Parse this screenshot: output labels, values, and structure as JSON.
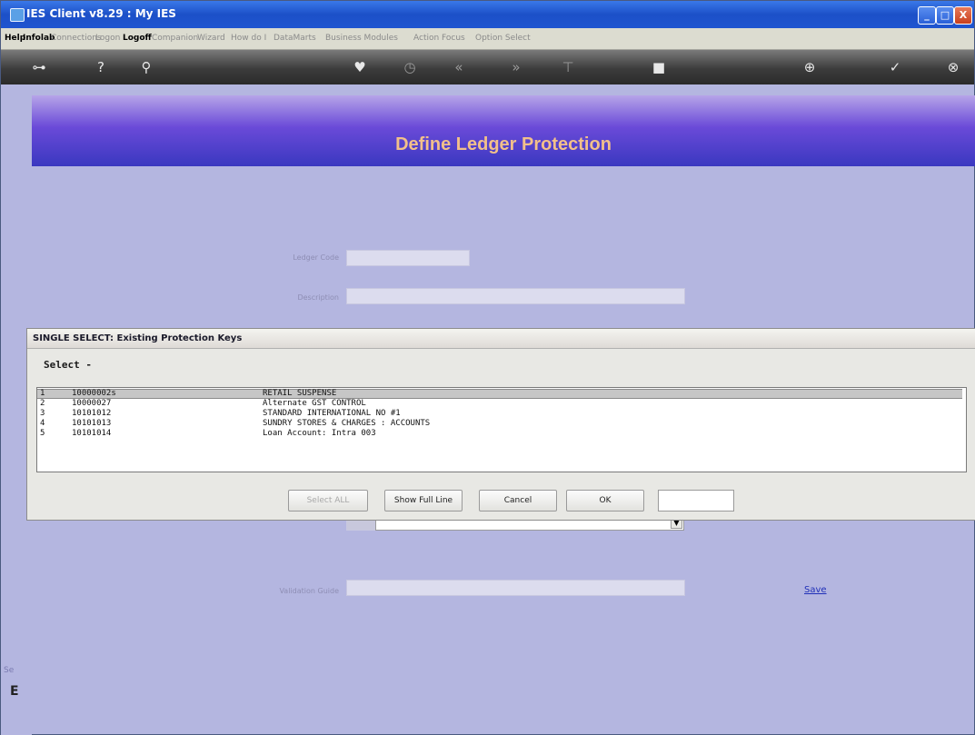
{
  "window": {
    "title": "IES Client v8.29 : My IES",
    "controls": [
      "_",
      "□",
      "X"
    ]
  },
  "menu": [
    {
      "label": "Help",
      "enabled": true
    },
    {
      "label": "Infolab",
      "enabled": true
    },
    {
      "label": "Connections",
      "enabled": false
    },
    {
      "label": "Logon",
      "enabled": false
    },
    {
      "label": "Logoff",
      "enabled": true
    },
    {
      "label": "Companion",
      "enabled": false
    },
    {
      "label": "Wizard",
      "enabled": false
    },
    {
      "label": "How do I",
      "enabled": false
    },
    {
      "label": "DataMarts",
      "enabled": false
    },
    {
      "label": "Business Modules",
      "enabled": false
    },
    {
      "label": "Action Focus",
      "enabled": false
    },
    {
      "label": "Option Select",
      "enabled": false
    }
  ],
  "toolbar": {
    "icons": [
      "key-icon",
      "help-icon",
      "search-icon",
      "heart-icon",
      "clock-icon",
      "rewind-icon",
      "fast-forward-icon",
      "filter-icon",
      "stop-icon",
      "plus-circle-icon",
      "check-circle-icon",
      "close-circle-icon"
    ],
    "glyphs": [
      "⊶",
      "?",
      "⚲",
      "♥",
      "◷",
      "«",
      "»",
      "⊤",
      "■",
      "⊕",
      "✓",
      "⊗"
    ]
  },
  "page": {
    "title": "Define Ledger Protection",
    "fields": {
      "ledger_code_label": "Ledger Code",
      "ledger_code_value": "",
      "description_label": "Description",
      "description_value": "",
      "validation_guide_label": "Validation Guide",
      "validation_guide_value": ""
    },
    "save_link": "Save"
  },
  "dialog": {
    "title": "SINGLE SELECT: Existing Protection Keys",
    "select_header": "Select -",
    "rows": [
      {
        "num": "1",
        "code": "10000002s",
        "desc": "RETAIL SUSPENSE",
        "selected": true
      },
      {
        "num": "2",
        "code": "10000027",
        "desc": "Alternate GST CONTROL",
        "selected": false
      },
      {
        "num": "3",
        "code": "10101012",
        "desc": "STANDARD INTERNATIONAL NO #1",
        "selected": false
      },
      {
        "num": "4",
        "code": "10101013",
        "desc": "SUNDRY STORES & CHARGES : ACCOUNTS",
        "selected": false
      },
      {
        "num": "5",
        "code": "10101014",
        "desc": "Loan Account: Intra 003",
        "selected": false
      }
    ],
    "buttons": {
      "select_all": "Select ALL",
      "show_full_line": "Show Full Line",
      "cancel": "Cancel",
      "ok": "OK"
    },
    "input_value": ""
  },
  "left_strip_text": [
    "Se",
    "E"
  ]
}
